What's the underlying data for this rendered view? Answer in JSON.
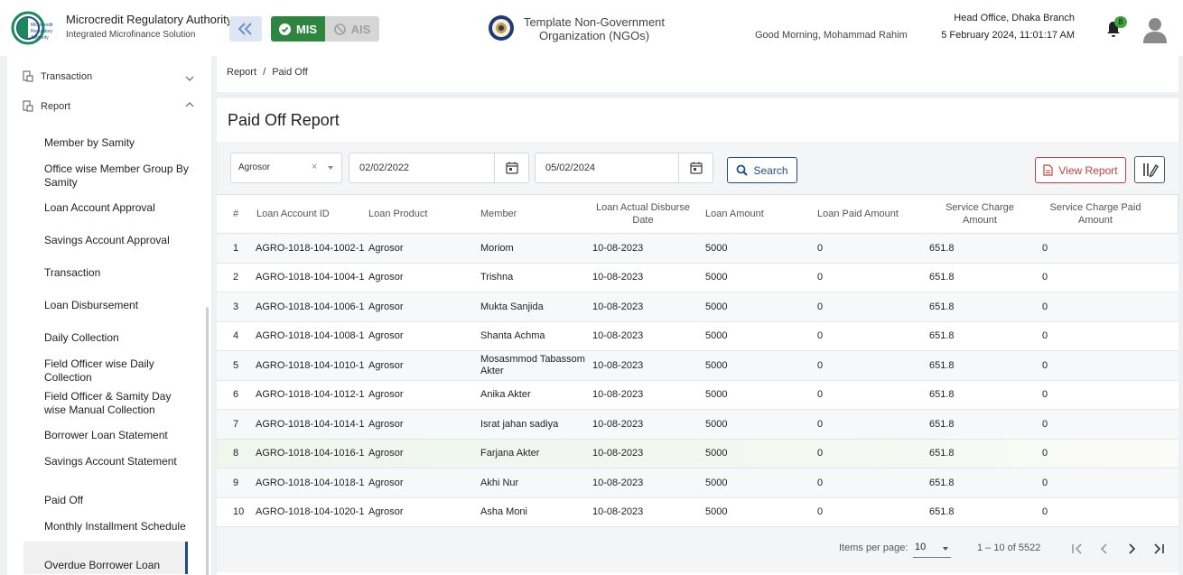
{
  "header": {
    "brand_title": "Microcredit Regulatory Authority",
    "brand_subtitle": "Integrated Microfinance Solution",
    "logo_text": "Microcredit Regulatory Authority",
    "mis_label": "MIS",
    "ais_label": "AIS",
    "org_name": "Template Non-Government Organization (NGOs)",
    "greeting": "Good Morning, Mohammad Rahim",
    "branch": "Head Office, Dhaka Branch",
    "datetime": "5 February 2024, 11:01:17 AM",
    "notification_count": "8"
  },
  "sidebar": {
    "parents": [
      {
        "label": "Transaction",
        "icon": "document-stack-icon",
        "expanded": false
      },
      {
        "label": "Report",
        "icon": "document-stack-icon",
        "expanded": true
      }
    ],
    "items": [
      {
        "label": "Member by Samity"
      },
      {
        "label": "Office wise Member Group By Samity"
      },
      {
        "label": "Loan Account Approval"
      },
      {
        "label": "Savings Account Approval"
      },
      {
        "label": "Transaction"
      },
      {
        "label": "Loan Disbursement"
      },
      {
        "label": "Daily Collection"
      },
      {
        "label": "Field Officer wise Daily Collection"
      },
      {
        "label": "Field Officer & Samity Day wise Manual Collection"
      },
      {
        "label": "Borrower Loan Statement"
      },
      {
        "label": "Savings Account Statement"
      },
      {
        "label": "Paid Off"
      },
      {
        "label": "Monthly Installment Schedule"
      },
      {
        "label": "Overdue Borrower Loan"
      }
    ],
    "active_item": "Paid Off"
  },
  "breadcrumb": {
    "root": "Report",
    "separator": "/",
    "current": "Paid Off"
  },
  "page": {
    "title": "Paid Off Report"
  },
  "filters": {
    "product": "Agrosor",
    "clear_symbol": "×",
    "from_date": "02/02/2022",
    "to_date": "05/02/2024",
    "search_label": "Search",
    "view_report_label": "View Report"
  },
  "table": {
    "columns": [
      "#",
      "Loan Account ID",
      "Loan Product",
      "Member",
      "Loan Actual Disburse Date",
      "Loan Amount",
      "Loan Paid Amount",
      "Service Charge Amount",
      "Service Charge Paid Amount"
    ],
    "rows": [
      [
        "1",
        "AGRO-1018-104-1002-1",
        "Agrosor",
        "Moriom",
        "10-08-2023",
        "5000",
        "0",
        "651.8",
        "0"
      ],
      [
        "2",
        "AGRO-1018-104-1004-1",
        "Agrosor",
        "Trishna",
        "10-08-2023",
        "5000",
        "0",
        "651.8",
        "0"
      ],
      [
        "3",
        "AGRO-1018-104-1006-1",
        "Agrosor",
        "Mukta Sanjida",
        "10-08-2023",
        "5000",
        "0",
        "651.8",
        "0"
      ],
      [
        "4",
        "AGRO-1018-104-1008-1",
        "Agrosor",
        "Shanta Achma",
        "10-08-2023",
        "5000",
        "0",
        "651.8",
        "0"
      ],
      [
        "5",
        "AGRO-1018-104-1010-1",
        "Agrosor",
        "Mosasmmod Tabassom Akter",
        "10-08-2023",
        "5000",
        "0",
        "651.8",
        "0"
      ],
      [
        "6",
        "AGRO-1018-104-1012-1",
        "Agrosor",
        "Anika Akter",
        "10-08-2023",
        "5000",
        "0",
        "651.8",
        "0"
      ],
      [
        "7",
        "AGRO-1018-104-1014-1",
        "Agrosor",
        "Israt jahan sadiya",
        "10-08-2023",
        "5000",
        "0",
        "651.8",
        "0"
      ],
      [
        "8",
        "AGRO-1018-104-1016-1",
        "Agrosor",
        "Farjana Akter",
        "10-08-2023",
        "5000",
        "0",
        "651.8",
        "0"
      ],
      [
        "9",
        "AGRO-1018-104-1018-1",
        "Agrosor",
        "Akhi Nur",
        "10-08-2023",
        "5000",
        "0",
        "651.8",
        "0"
      ],
      [
        "10",
        "AGRO-1018-104-1020-1",
        "Agrosor",
        "Asha Moni",
        "10-08-2023",
        "5000",
        "0",
        "651.8",
        "0"
      ]
    ]
  },
  "pagination": {
    "items_per_page_label": "Items per page:",
    "items_per_page": "10",
    "range": "1 – 10 of 5522"
  },
  "colors": {
    "primary": "#1f4a8a",
    "mis_green": "#2e8540",
    "danger": "#c43f3f",
    "badge_green": "#3fa63f"
  }
}
